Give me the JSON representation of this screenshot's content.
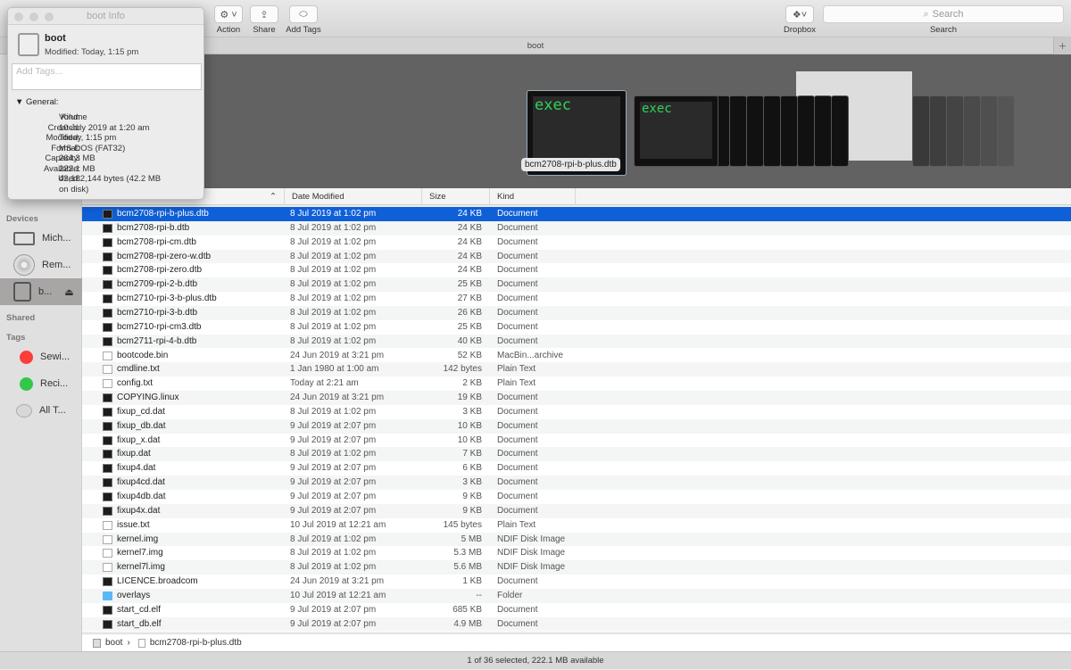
{
  "toolbar": {
    "action": "Action",
    "share": "Share",
    "add_tags": "Add Tags",
    "dropbox": "Dropbox",
    "search_placeholder": "Search",
    "search_label": "Search"
  },
  "tab": {
    "title": "boot",
    "plus": "+"
  },
  "sidebar": {
    "devices_header": "Devices",
    "shared_header": "Shared",
    "tags_header": "Tags",
    "devices": [
      {
        "label": "Mich...",
        "icon": "laptop-icon"
      },
      {
        "label": "Rem...",
        "icon": "disc-icon"
      },
      {
        "label": "b...",
        "icon": "drive-icon",
        "selected": true
      }
    ],
    "tags": [
      {
        "label": "Sewi...",
        "color": "#fc3d39"
      },
      {
        "label": "Reci...",
        "color": "#33c748"
      },
      {
        "label": "All T...",
        "color": "#d8d8d8"
      }
    ]
  },
  "coverflow": {
    "selected_label": "bcm2708-rpi-b-plus.dtb",
    "preview_text": "exec"
  },
  "columns": {
    "date": "Date Modified",
    "size": "Size",
    "kind": "Kind"
  },
  "files": [
    {
      "name": "bcm2708-rpi-b-plus.dtb",
      "date": "8 Jul 2019 at 1:02 pm",
      "size": "24 KB",
      "kind": "Document",
      "icon": "exec",
      "selected": true
    },
    {
      "name": "bcm2708-rpi-b.dtb",
      "date": "8 Jul 2019 at 1:02 pm",
      "size": "24 KB",
      "kind": "Document",
      "icon": "exec"
    },
    {
      "name": "bcm2708-rpi-cm.dtb",
      "date": "8 Jul 2019 at 1:02 pm",
      "size": "24 KB",
      "kind": "Document",
      "icon": "exec"
    },
    {
      "name": "bcm2708-rpi-zero-w.dtb",
      "date": "8 Jul 2019 at 1:02 pm",
      "size": "24 KB",
      "kind": "Document",
      "icon": "exec"
    },
    {
      "name": "bcm2708-rpi-zero.dtb",
      "date": "8 Jul 2019 at 1:02 pm",
      "size": "24 KB",
      "kind": "Document",
      "icon": "exec"
    },
    {
      "name": "bcm2709-rpi-2-b.dtb",
      "date": "8 Jul 2019 at 1:02 pm",
      "size": "25 KB",
      "kind": "Document",
      "icon": "exec"
    },
    {
      "name": "bcm2710-rpi-3-b-plus.dtb",
      "date": "8 Jul 2019 at 1:02 pm",
      "size": "27 KB",
      "kind": "Document",
      "icon": "exec"
    },
    {
      "name": "bcm2710-rpi-3-b.dtb",
      "date": "8 Jul 2019 at 1:02 pm",
      "size": "26 KB",
      "kind": "Document",
      "icon": "exec"
    },
    {
      "name": "bcm2710-rpi-cm3.dtb",
      "date": "8 Jul 2019 at 1:02 pm",
      "size": "25 KB",
      "kind": "Document",
      "icon": "exec"
    },
    {
      "name": "bcm2711-rpi-4-b.dtb",
      "date": "8 Jul 2019 at 1:02 pm",
      "size": "40 KB",
      "kind": "Document",
      "icon": "exec"
    },
    {
      "name": "bootcode.bin",
      "date": "24 Jun 2019 at 3:21 pm",
      "size": "52 KB",
      "kind": "MacBin...archive",
      "icon": "text"
    },
    {
      "name": "cmdline.txt",
      "date": "1 Jan 1980 at 1:00 am",
      "size": "142 bytes",
      "kind": "Plain Text",
      "icon": "text"
    },
    {
      "name": "config.txt",
      "date": "Today at 2:21 am",
      "size": "2 KB",
      "kind": "Plain Text",
      "icon": "text"
    },
    {
      "name": "COPYING.linux",
      "date": "24 Jun 2019 at 3:21 pm",
      "size": "19 KB",
      "kind": "Document",
      "icon": "exec"
    },
    {
      "name": "fixup_cd.dat",
      "date": "8 Jul 2019 at 1:02 pm",
      "size": "3 KB",
      "kind": "Document",
      "icon": "exec"
    },
    {
      "name": "fixup_db.dat",
      "date": "9 Jul 2019 at 2:07 pm",
      "size": "10 KB",
      "kind": "Document",
      "icon": "exec"
    },
    {
      "name": "fixup_x.dat",
      "date": "9 Jul 2019 at 2:07 pm",
      "size": "10 KB",
      "kind": "Document",
      "icon": "exec"
    },
    {
      "name": "fixup.dat",
      "date": "8 Jul 2019 at 1:02 pm",
      "size": "7 KB",
      "kind": "Document",
      "icon": "exec"
    },
    {
      "name": "fixup4.dat",
      "date": "9 Jul 2019 at 2:07 pm",
      "size": "6 KB",
      "kind": "Document",
      "icon": "exec"
    },
    {
      "name": "fixup4cd.dat",
      "date": "9 Jul 2019 at 2:07 pm",
      "size": "3 KB",
      "kind": "Document",
      "icon": "exec"
    },
    {
      "name": "fixup4db.dat",
      "date": "9 Jul 2019 at 2:07 pm",
      "size": "9 KB",
      "kind": "Document",
      "icon": "exec"
    },
    {
      "name": "fixup4x.dat",
      "date": "9 Jul 2019 at 2:07 pm",
      "size": "9 KB",
      "kind": "Document",
      "icon": "exec"
    },
    {
      "name": "issue.txt",
      "date": "10 Jul 2019 at 12:21 am",
      "size": "145 bytes",
      "kind": "Plain Text",
      "icon": "text"
    },
    {
      "name": "kernel.img",
      "date": "8 Jul 2019 at 1:02 pm",
      "size": "5 MB",
      "kind": "NDIF Disk Image",
      "icon": "text"
    },
    {
      "name": "kernel7.img",
      "date": "8 Jul 2019 at 1:02 pm",
      "size": "5.3 MB",
      "kind": "NDIF Disk Image",
      "icon": "text"
    },
    {
      "name": "kernel7l.img",
      "date": "8 Jul 2019 at 1:02 pm",
      "size": "5.6 MB",
      "kind": "NDIF Disk Image",
      "icon": "text"
    },
    {
      "name": "LICENCE.broadcom",
      "date": "24 Jun 2019 at 3:21 pm",
      "size": "1 KB",
      "kind": "Document",
      "icon": "exec"
    },
    {
      "name": "overlays",
      "date": "10 Jul 2019 at 12:21 am",
      "size": "--",
      "kind": "Folder",
      "icon": "folder"
    },
    {
      "name": "start_cd.elf",
      "date": "9 Jul 2019 at 2:07 pm",
      "size": "685 KB",
      "kind": "Document",
      "icon": "exec"
    },
    {
      "name": "start_db.elf",
      "date": "9 Jul 2019 at 2:07 pm",
      "size": "4.9 MB",
      "kind": "Document",
      "icon": "exec"
    }
  ],
  "pathbar": {
    "volume": "boot",
    "separator": "›",
    "file": "bcm2708-rpi-b-plus.dtb"
  },
  "status": "1 of 36 selected, 222.1 MB available",
  "info": {
    "window_title": "boot Info",
    "name": "boot",
    "modified_line": "Modified: Today, 1:15 pm",
    "tags_placeholder": "Add Tags...",
    "section": "General:",
    "fields": [
      {
        "k": "Kind:",
        "v": "Volume"
      },
      {
        "k": "Created:",
        "v": "10 July 2019 at 1:20 am"
      },
      {
        "k": "Modified:",
        "v": "Today, 1:15 pm"
      },
      {
        "k": "Format:",
        "v": "MS-DOS (FAT32)"
      },
      {
        "k": "Capacity:",
        "v": "264.3 MB"
      },
      {
        "k": "Available:",
        "v": "222.1 MB"
      },
      {
        "k": "Used:",
        "v": "42,182,144 bytes (42.2 MB"
      },
      {
        "k": "",
        "v": "on disk)"
      }
    ]
  },
  "colors": {
    "selection": "#0f5fd7",
    "preview_text": "#2fd35a"
  }
}
